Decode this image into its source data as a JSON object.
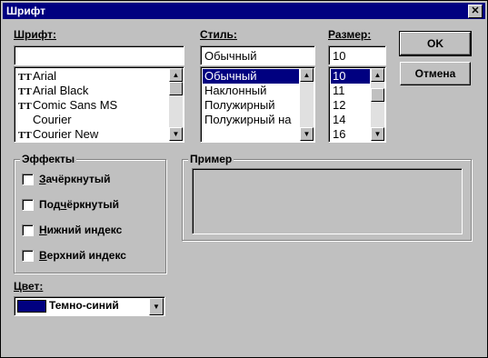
{
  "window": {
    "title": "Шрифт",
    "close_glyph": "✕"
  },
  "font": {
    "label": "Шрифт:",
    "value": "",
    "items": [
      {
        "name": "Arial",
        "truetype": true,
        "selected": false
      },
      {
        "name": "Arial Black",
        "truetype": true,
        "selected": false
      },
      {
        "name": "Comic Sans MS",
        "truetype": true,
        "selected": false
      },
      {
        "name": "Courier",
        "truetype": false,
        "selected": false
      },
      {
        "name": "Courier New",
        "truetype": true,
        "selected": false
      }
    ]
  },
  "style": {
    "label": "Стиль:",
    "value": "Обычный",
    "items": [
      "Обычный",
      "Наклонный",
      "Полужирный",
      "Полужирный на"
    ],
    "selected_index": 0
  },
  "size": {
    "label": "Размер:",
    "value": "10",
    "items": [
      "10",
      "11",
      "12",
      "14",
      "16"
    ],
    "selected_index": 0
  },
  "buttons": {
    "ok": "OK",
    "cancel": "Отмена"
  },
  "effects": {
    "title": "Эффекты",
    "strikeout": {
      "first": "З",
      "rest": "ачёркнутый",
      "checked": false
    },
    "underline": {
      "pre": "Под",
      "accel": "ч",
      "post": "ёркнутый",
      "checked": false
    },
    "subscript": {
      "accel": "Н",
      "rest": "ижний индекс",
      "checked": false
    },
    "superscript": {
      "accel": "В",
      "rest": "ерхний индекс",
      "checked": false
    }
  },
  "sample": {
    "title": "Пример"
  },
  "color": {
    "label": "Цвет:",
    "value": "Темно-синий",
    "swatch": "#000080"
  },
  "icons": {
    "truetype": "TT",
    "scroll_up": "▲",
    "scroll_down": "▼"
  }
}
